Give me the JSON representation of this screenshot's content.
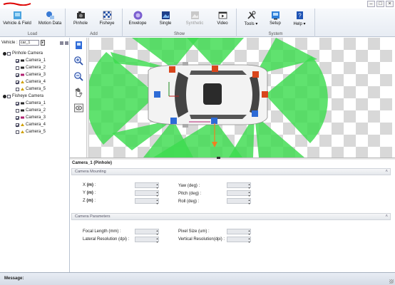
{
  "ribbon": {
    "groups": [
      {
        "label": "Load",
        "buttons": [
          {
            "label": "Vehicle & Field",
            "icon": "vehicle-field-icon"
          },
          {
            "label": "Motion Data",
            "icon": "motion-data-icon"
          }
        ]
      },
      {
        "label": "Add",
        "buttons": [
          {
            "label": "Pinhole",
            "icon": "pinhole-camera-icon"
          },
          {
            "label": "Fisheye",
            "icon": "fisheye-camera-icon"
          }
        ]
      },
      {
        "label": "Show",
        "buttons": [
          {
            "label": "Envelope",
            "icon": "envelope-icon"
          },
          {
            "label": "Single",
            "icon": "single-view-icon"
          },
          {
            "label": "Synthetic",
            "icon": "synthetic-view-icon"
          },
          {
            "label": "Video",
            "icon": "video-icon"
          }
        ]
      },
      {
        "label": "System",
        "buttons": [
          {
            "label": "Tools",
            "icon": "tools-icon"
          },
          {
            "label": "Setup",
            "icon": "setup-icon"
          },
          {
            "label": "Help",
            "icon": "help-icon"
          }
        ]
      }
    ]
  },
  "window": {
    "minimize": "–",
    "maximize": "□",
    "close": "×"
  },
  "tree": {
    "vehicle_label": "Vehicle :",
    "vehicle_value": "car_1",
    "groups": [
      {
        "label": "Pinhole Camera",
        "checked": false,
        "cameras": [
          {
            "label": "Camera_1",
            "checked": true,
            "color": "#2a2a2a"
          },
          {
            "label": "Camera_2",
            "checked": false,
            "color": "#2a2a2a"
          },
          {
            "label": "Camera_3",
            "checked": true,
            "color": "#b02070"
          },
          {
            "label": "Camera_4",
            "checked": true,
            "color": "#d0a000"
          },
          {
            "label": "Camera_5",
            "checked": false,
            "color": "#d0a000"
          }
        ]
      },
      {
        "label": "Fisheye Camera",
        "checked": false,
        "cameras": [
          {
            "label": "Camera_1",
            "checked": true,
            "color": "#2a2a2a"
          },
          {
            "label": "Camera_2",
            "checked": false,
            "color": "#2a2a2a"
          },
          {
            "label": "Camera_3",
            "checked": true,
            "color": "#b02070"
          },
          {
            "label": "Camera_4",
            "checked": true,
            "color": "#d0a000"
          },
          {
            "label": "Camera_5",
            "checked": false,
            "color": "#d0a000"
          }
        ]
      }
    ]
  },
  "tools": [
    "select-icon",
    "zoom-in-icon",
    "zoom-out-icon",
    "pan-hand-icon",
    "view-reset-icon"
  ],
  "props": {
    "title": "Camera_1 (Pinhole)",
    "mounting": {
      "header": "Camera Mounting",
      "x": {
        "name": "X",
        "unit": "(m)"
      },
      "y": {
        "name": "Y",
        "unit": "(m)"
      },
      "z": {
        "name": "Z",
        "unit": "(m)"
      },
      "yaw": {
        "name": "Yaw",
        "unit": "(deg)"
      },
      "pitch": {
        "name": "Pitch",
        "unit": "(deg)"
      },
      "roll": {
        "name": "Roll",
        "unit": "(deg)"
      }
    },
    "params": {
      "header": "Camera Parameters",
      "focal": "Focal Length (mm)",
      "pixel": "Pixel Size (um)",
      "lat_res": "Lateral Resolution (dpi)",
      "vert_res": "Vertical Resolution(dpi)"
    }
  },
  "status": {
    "message_label": "Message:"
  },
  "colors": {
    "cone": "#3ddc4f",
    "camera_red": "#d9461c",
    "camera_blue": "#2d6bd6",
    "accent": "#2b579a"
  }
}
